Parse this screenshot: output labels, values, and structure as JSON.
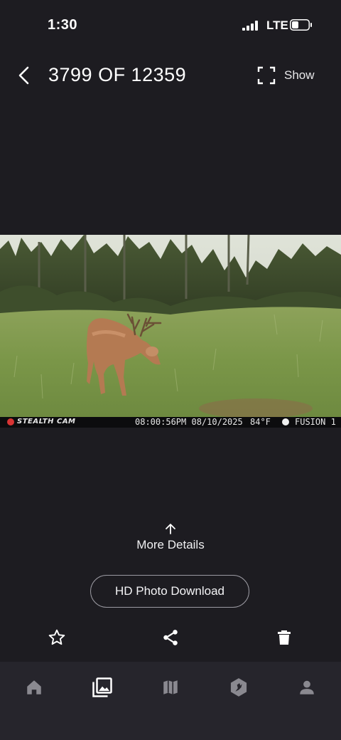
{
  "status_bar": {
    "time": "1:30",
    "network": "LTE"
  },
  "header": {
    "counter": "3799 OF 12359",
    "show_label": "Show"
  },
  "photo": {
    "brand": "STEALTH CAM",
    "datetime": "08:00:56PM 08/10/2025",
    "temperature": "84°F",
    "camera": "FUSION 1"
  },
  "details": {
    "more_label": "More Details"
  },
  "download": {
    "label": "HD Photo Download"
  },
  "actions": [
    "star-icon",
    "share-icon",
    "trash-icon"
  ],
  "nav": {
    "items": [
      "home-icon",
      "gallery-icon",
      "map-icon",
      "hunt-icon",
      "profile-icon"
    ],
    "active_index": 1
  },
  "colors": {
    "background": "#1d1c21",
    "nav_background": "#26252c",
    "inactive_icon": "#8a8990",
    "active_icon": "#ffffff"
  }
}
